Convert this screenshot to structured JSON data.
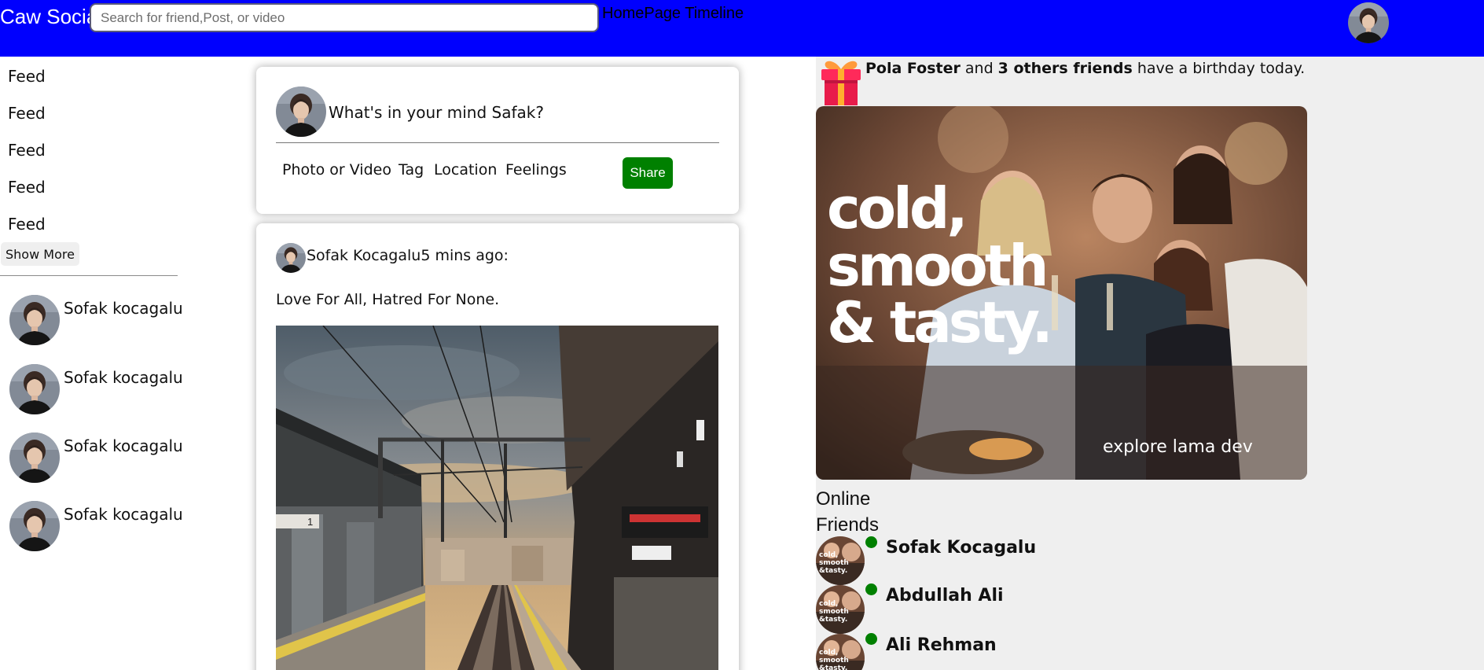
{
  "topbar": {
    "brand": "Caw Social",
    "search_placeholder": "Search for friend,Post, or video",
    "links": [
      "HomePage",
      "Timeline"
    ]
  },
  "sidebar": {
    "items": [
      {
        "label": "Feed"
      },
      {
        "label": "Feed"
      },
      {
        "label": "Feed"
      },
      {
        "label": "Feed"
      },
      {
        "label": "Feed"
      }
    ],
    "show_more": "Show More",
    "friends": [
      {
        "name": "Sofak kocagalu"
      },
      {
        "name": "Sofak kocagalu"
      },
      {
        "name": "Sofak kocagalu"
      },
      {
        "name": "Sofak kocagalu"
      }
    ]
  },
  "share": {
    "prompt": "What's in your mind Safak?",
    "options": [
      "Photo or Video",
      "Tag",
      "Location",
      "Feelings"
    ],
    "button": "Share"
  },
  "post": {
    "author": "Sofak Kocagalu",
    "time": "5 mins ago:",
    "text": "Love For All, Hatred For None."
  },
  "rightbar": {
    "birthday": {
      "name": "Pola Foster",
      "connector": " and ",
      "others": "3 others friends",
      "suffix": " have a birthday today."
    },
    "promo": {
      "line1": "cold,",
      "line2": "smooth",
      "line3": "& tasty.",
      "tagline": "explore lama dev"
    },
    "online_title": "Online Friends",
    "online_friends": [
      {
        "name": "Sofak Kocagalu"
      },
      {
        "name": "Abdullah Ali"
      },
      {
        "name": "Ali Rehman"
      }
    ]
  },
  "colors": {
    "topbar": "#0000fe",
    "share_button": "#008000",
    "online_dot": "#008000",
    "right_panel_bg": "#efefef"
  },
  "icons": {
    "gift": "gift-icon",
    "online": "online-dot-icon"
  }
}
